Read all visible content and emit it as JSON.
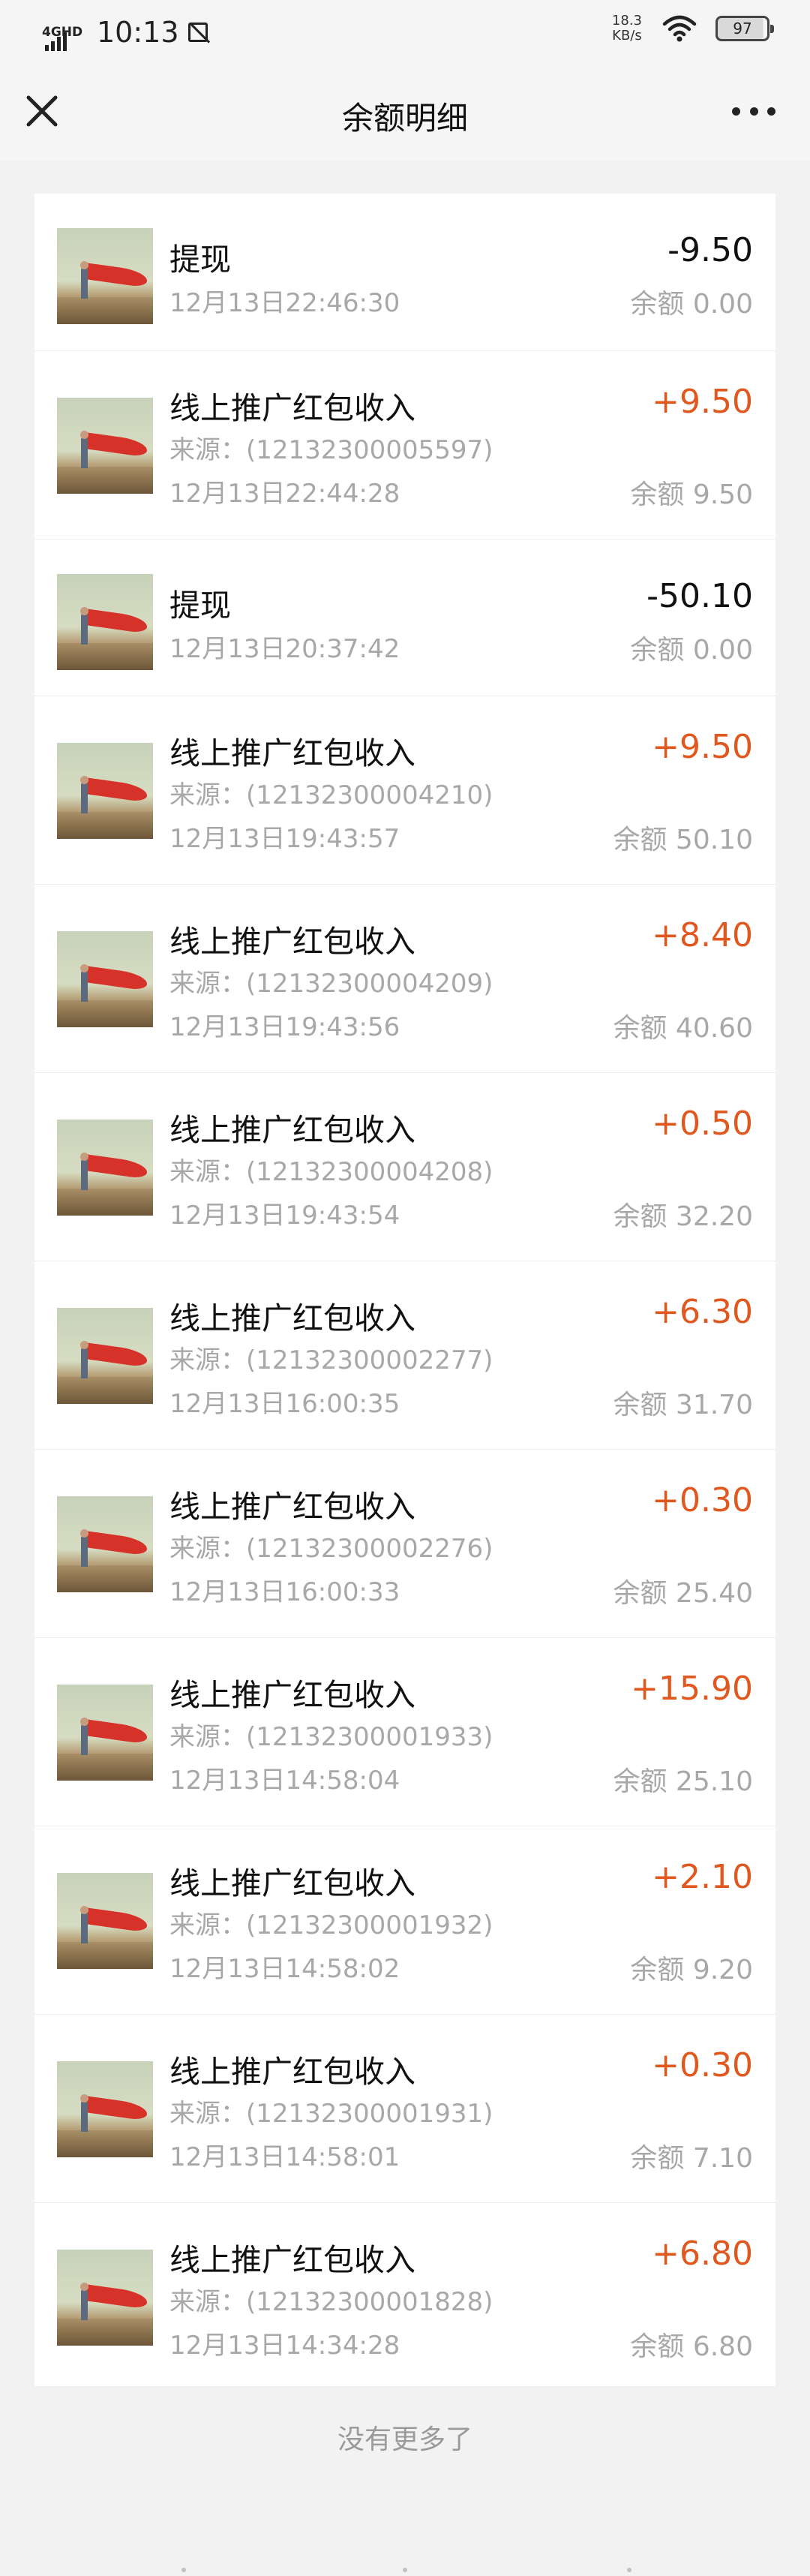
{
  "status_bar": {
    "network": "4GHD",
    "time": "10:13",
    "speed_value": "18.3",
    "speed_unit": "KB/s",
    "battery": "97",
    "icons": [
      "signal-icon",
      "no-image-icon",
      "wifi-icon",
      "battery-icon"
    ]
  },
  "header": {
    "title": "余额明细",
    "close_icon": "close-icon",
    "more_icon": "more-icon"
  },
  "colors": {
    "income": "#e0581e",
    "withdraw": "#111111",
    "secondary": "#a8a8a8"
  },
  "records": [
    {
      "title": "提现",
      "source": "",
      "time": "12月13日22:46:30",
      "amount": "-9.50",
      "balance": "余额 0.00",
      "type": "withdraw"
    },
    {
      "title": "线上推广红包收入",
      "source": "来源：(12132300005597)",
      "time": "12月13日22:44:28",
      "amount": "+9.50",
      "balance": "余额 9.50",
      "type": "income"
    },
    {
      "title": "提现",
      "source": "",
      "time": "12月13日20:37:42",
      "amount": "-50.10",
      "balance": "余额 0.00",
      "type": "withdraw"
    },
    {
      "title": "线上推广红包收入",
      "source": "来源：(12132300004210)",
      "time": "12月13日19:43:57",
      "amount": "+9.50",
      "balance": "余额 50.10",
      "type": "income"
    },
    {
      "title": "线上推广红包收入",
      "source": "来源：(12132300004209)",
      "time": "12月13日19:43:56",
      "amount": "+8.40",
      "balance": "余额 40.60",
      "type": "income"
    },
    {
      "title": "线上推广红包收入",
      "source": "来源：(12132300004208)",
      "time": "12月13日19:43:54",
      "amount": "+0.50",
      "balance": "余额 32.20",
      "type": "income"
    },
    {
      "title": "线上推广红包收入",
      "source": "来源：(12132300002277)",
      "time": "12月13日16:00:35",
      "amount": "+6.30",
      "balance": "余额 31.70",
      "type": "income"
    },
    {
      "title": "线上推广红包收入",
      "source": "来源：(12132300002276)",
      "time": "12月13日16:00:33",
      "amount": "+0.30",
      "balance": "余额 25.40",
      "type": "income"
    },
    {
      "title": "线上推广红包收入",
      "source": "来源：(12132300001933)",
      "time": "12月13日14:58:04",
      "amount": "+15.90",
      "balance": "余额 25.10",
      "type": "income"
    },
    {
      "title": "线上推广红包收入",
      "source": "来源：(12132300001932)",
      "time": "12月13日14:58:02",
      "amount": "+2.10",
      "balance": "余额 9.20",
      "type": "income"
    },
    {
      "title": "线上推广红包收入",
      "source": "来源：(12132300001931)",
      "time": "12月13日14:58:01",
      "amount": "+0.30",
      "balance": "余额 7.10",
      "type": "income"
    },
    {
      "title": "线上推广红包收入",
      "source": "来源：(12132300001828)",
      "time": "12月13日14:34:28",
      "amount": "+6.80",
      "balance": "余额 6.80",
      "type": "income"
    }
  ],
  "footer": {
    "no_more": "没有更多了"
  }
}
